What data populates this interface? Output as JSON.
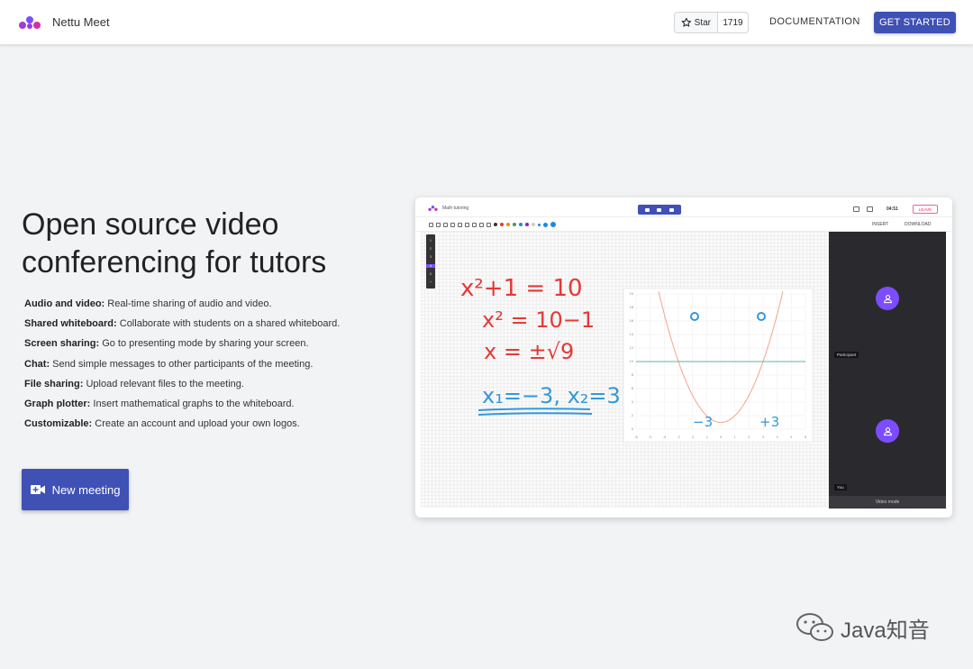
{
  "nav": {
    "brand": "Nettu Meet",
    "star_label": "Star",
    "star_count": "1719",
    "docs_label": "DOCUMENTATION",
    "start_label": "GET STARTED",
    "logo_icon": "nettu-logo-icon",
    "star_icon": "star-outline-icon"
  },
  "hero": {
    "title": "Open source video conferencing for tutors",
    "features": [
      {
        "name": "Audio and video:",
        "desc": "Real-time sharing of audio and video."
      },
      {
        "name": "Shared whiteboard:",
        "desc": "Collaborate with students on a shared whiteboard."
      },
      {
        "name": "Screen sharing:",
        "desc": "Go to presenting mode by sharing your screen."
      },
      {
        "name": "Chat:",
        "desc": "Send simple messages to other participants of the meeting."
      },
      {
        "name": "File sharing:",
        "desc": "Upload relevant files to the meeting."
      },
      {
        "name": "Graph plotter:",
        "desc": "Insert mathematical graphs to the whiteboard."
      },
      {
        "name": "Customizable:",
        "desc": "Create an account and upload your own logos."
      }
    ],
    "new_meeting_label": "New meeting",
    "new_meeting_icon": "video-camera-plus-icon"
  },
  "preview": {
    "meeting_title": "Math tutoring",
    "timer": "04:51",
    "leave_label": "LEAVE",
    "insert_label": "INSERT",
    "download_label": "DOWNLOAD",
    "pages": [
      "1",
      "2",
      "3",
      "4",
      "5",
      "+"
    ],
    "active_page": "4",
    "participant_label": "Participant",
    "self_label": "You",
    "video_mode_label": "Video mode",
    "equations": {
      "line1": "x²+1 = 10",
      "line2": "x² = 10−1",
      "line3": "x = ±√9",
      "line4": "x₁=−3, x₂=3",
      "root_left": "−3",
      "root_right": "+3"
    },
    "graph": {
      "x_ticks": [
        "-6",
        "-5",
        "-4",
        "-3",
        "-2",
        "-1",
        "0",
        "1",
        "2",
        "3",
        "4",
        "5",
        "6"
      ],
      "y_ticks": [
        "20",
        "18",
        "16",
        "14",
        "12",
        "10",
        "8",
        "6",
        "4",
        "2",
        "0"
      ],
      "function": "y = x² + 1",
      "horizontal_line_y": 10
    },
    "colors": {
      "accent": "#3f51b5",
      "purple": "#7c4dff",
      "red_ink": "#e53935",
      "teal_ink": "#1abc9c",
      "blue_ink": "#3498db"
    }
  },
  "watermark": {
    "text": "Java知音",
    "icon": "wechat-icon"
  }
}
